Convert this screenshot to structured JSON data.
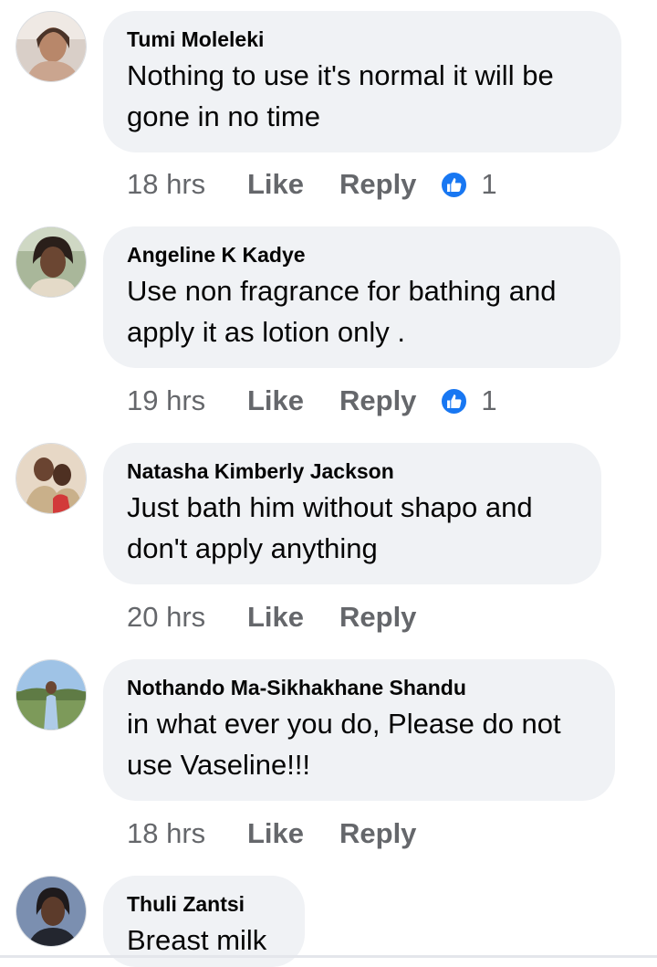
{
  "comments": [
    {
      "author": "Tumi Moleleki",
      "lines": [
        "Nothing to use it's normal it will be",
        "gone in no time"
      ],
      "time": "18 hrs",
      "like_label": "Like",
      "reply_label": "Reply",
      "reactions": "1",
      "reaction_icon": "thumbs-up-icon"
    },
    {
      "author": "Angeline K Kadye",
      "lines": [
        "Use non fragrance for bathing and",
        "apply it as lotion only ."
      ],
      "time": "19 hrs",
      "like_label": "Like",
      "reply_label": "Reply",
      "reactions": "1",
      "reaction_icon": "thumbs-up-icon"
    },
    {
      "author": "Natasha Kimberly Jackson",
      "lines": [
        "Just bath him without shapo and",
        "don't apply anything"
      ],
      "time": "20 hrs",
      "like_label": "Like",
      "reply_label": "Reply"
    },
    {
      "author": "Nothando Ma-Sikhakhane Shandu",
      "lines": [
        "in what ever you do, Please do not",
        "use Vaseline!!!"
      ],
      "time": "18 hrs",
      "like_label": "Like",
      "reply_label": "Reply"
    },
    {
      "author": "Thuli Zantsi",
      "lines": [
        "Breast milk"
      ]
    }
  ],
  "colors": {
    "bubble": "#f0f2f5",
    "meta_text": "#65676b",
    "reaction_blue": "#1877f2",
    "text": "#050505"
  }
}
